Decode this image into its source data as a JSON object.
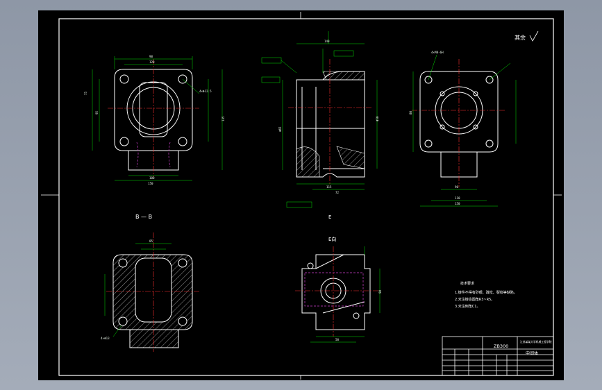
{
  "drawing": {
    "roughness_note": "其余",
    "section_label": "B — B",
    "view_label_e": "E向",
    "view_mark_e": "E",
    "tech_req": {
      "title": "技术要求",
      "lines": [
        "1.铸件不得有砂眼、疏松、裂纹等缺陷。",
        "2.未注铸造圆角R3~R5。",
        "3.未注倒角C1。"
      ]
    },
    "title_block": {
      "drawing_no": "ZB300",
      "part_name": "中间体",
      "school": "江苏某某大学机械工程学院"
    },
    "dims": {
      "top_left_w": "90",
      "top_left_w2": "120",
      "left_h1": "75",
      "left_h2": "95",
      "left_h3": "135",
      "bottom_w": "100",
      "bottom_w2": "150",
      "hole_note": "4×Φ12.5",
      "side_h1": "140",
      "side_h2": "Φ50",
      "side_h3": "Φ65",
      "side_bot": "115",
      "side_bot2": "72",
      "r_top": "4×M8-6H",
      "r_w": "90",
      "r_w2": "110",
      "r_w3": "150",
      "r_h": "80",
      "e_w": "50",
      "e_h": "90",
      "bb_w": "85",
      "bb_hole": "4×Φ13"
    },
    "colors": {
      "geometry": "#ffffff",
      "dimension": "#00e000",
      "center": "#ff3030",
      "hidden": "#d040d0",
      "border": "#ffffff"
    }
  }
}
